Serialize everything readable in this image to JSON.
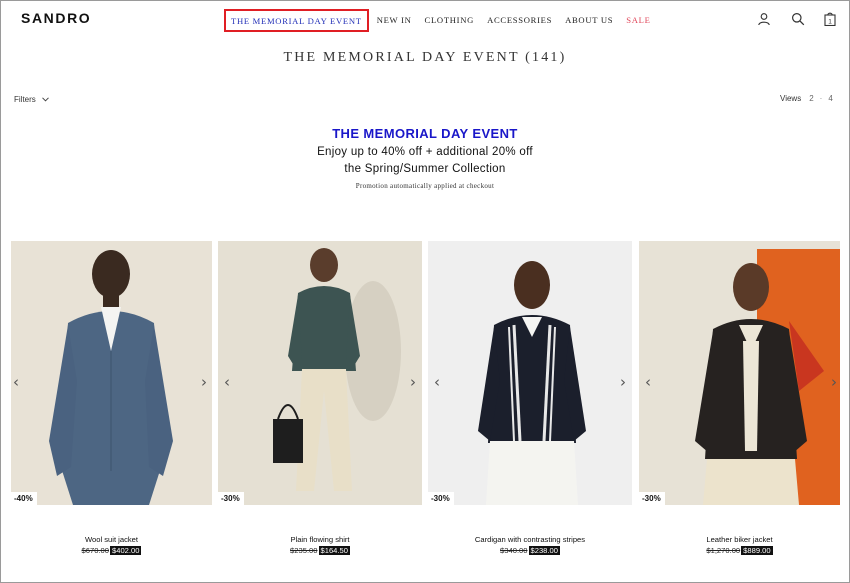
{
  "brand": {
    "logo": "SANDRO"
  },
  "nav": {
    "items": [
      {
        "label": "THE MEMORIAL DAY EVENT"
      },
      {
        "label": "NEW IN"
      },
      {
        "label": "CLOTHING"
      },
      {
        "label": "ACCESSORIES"
      },
      {
        "label": "ABOUT US"
      },
      {
        "label": "SALE"
      }
    ]
  },
  "header_icons": [
    "account-icon",
    "search-icon",
    "bag-icon"
  ],
  "cart": {
    "count": "1"
  },
  "page": {
    "heading": "THE MEMORIAL DAY EVENT (141)"
  },
  "toolbar": {
    "filters_label": "Filters",
    "views_label": "Views",
    "view_options": [
      "2",
      "4"
    ]
  },
  "promo": {
    "title": "THE MEMORIAL DAY EVENT",
    "line1": "Enjoy up to 40% off + additional 20% off",
    "line2": "the Spring/Summer Collection",
    "note": "Promotion automatically applied at checkout"
  },
  "products": [
    {
      "name": "Wool suit jacket",
      "discount": "-40%",
      "old_price": "$670.00",
      "new_price": "$402.00"
    },
    {
      "name": "Plain flowing shirt",
      "discount": "-30%",
      "old_price": "$235.00",
      "new_price": "$164.50"
    },
    {
      "name": "Cardigan with contrasting stripes",
      "discount": "-30%",
      "old_price": "$340.00",
      "new_price": "$238.00"
    },
    {
      "name": "Leather biker jacket",
      "discount": "-30%",
      "old_price": "$1,270.00",
      "new_price": "$889.00"
    }
  ],
  "colors": {
    "accent_blue": "#1a17c9",
    "sale_red": "#e0475a",
    "highlight_border": "#e01e24"
  }
}
